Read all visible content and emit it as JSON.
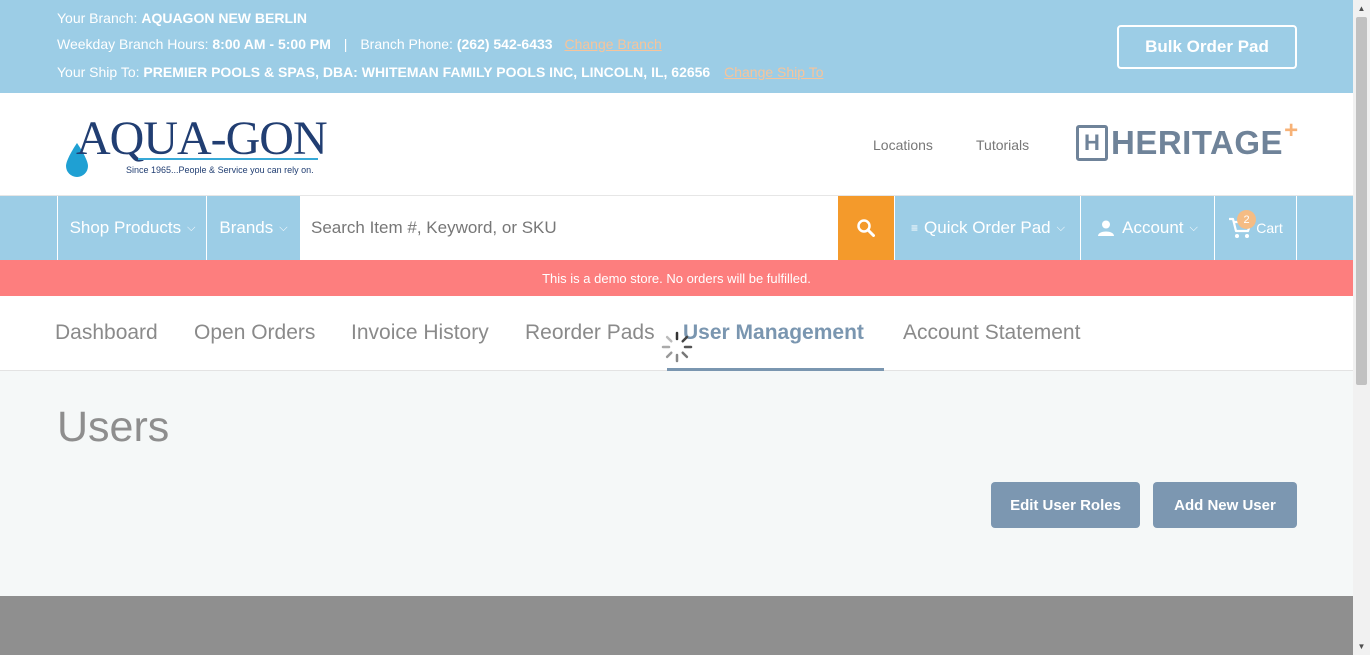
{
  "topbar": {
    "branch_label": "Your Branch:",
    "branch_value": "AQUAGON NEW BERLIN",
    "hours_label": "Weekday Branch Hours:",
    "hours_value": "8:00 AM - 5:00 PM",
    "separator": "|",
    "phone_label": "Branch Phone:",
    "phone_value": "(262) 542-6433",
    "change_branch": "Change Branch",
    "shipto_label": "Your Ship To:",
    "shipto_value": "PREMIER POOLS & SPAS, DBA: WHITEMAN FAMILY POOLS INC, LINCOLN, IL, 62656",
    "change_shipto": "Change Ship To",
    "bulk_order_pad": "Bulk Order Pad"
  },
  "header": {
    "logo_text": "AQUA-GON",
    "logo_tagline": "Since 1965...People & Service you can rely on.",
    "locations": "Locations",
    "tutorials": "Tutorials",
    "heritage_text": "HERITAGE",
    "heritage_plus": "+"
  },
  "nav": {
    "shop_products": "Shop Products",
    "brands": "Brands",
    "search_placeholder": "Search Item #, Keyword, or SKU",
    "quick_order_pad": "Quick Order Pad",
    "account": "Account",
    "cart": "Cart",
    "cart_count": "2"
  },
  "demo_banner": "This is a demo store. No orders will be fulfilled.",
  "tabs": [
    {
      "label": "Dashboard"
    },
    {
      "label": "Open Orders"
    },
    {
      "label": "Invoice History"
    },
    {
      "label": "Reorder Pads"
    },
    {
      "label": "User Management"
    },
    {
      "label": "Account Statement"
    }
  ],
  "main": {
    "title": "Users",
    "edit_roles": "Edit User Roles",
    "add_user": "Add New User"
  },
  "colors": {
    "topbar_bg": "#9ccde6",
    "accent_orange": "#f49a2b",
    "banner_red": "#fd7e7e",
    "slate": "#7c97b1"
  }
}
